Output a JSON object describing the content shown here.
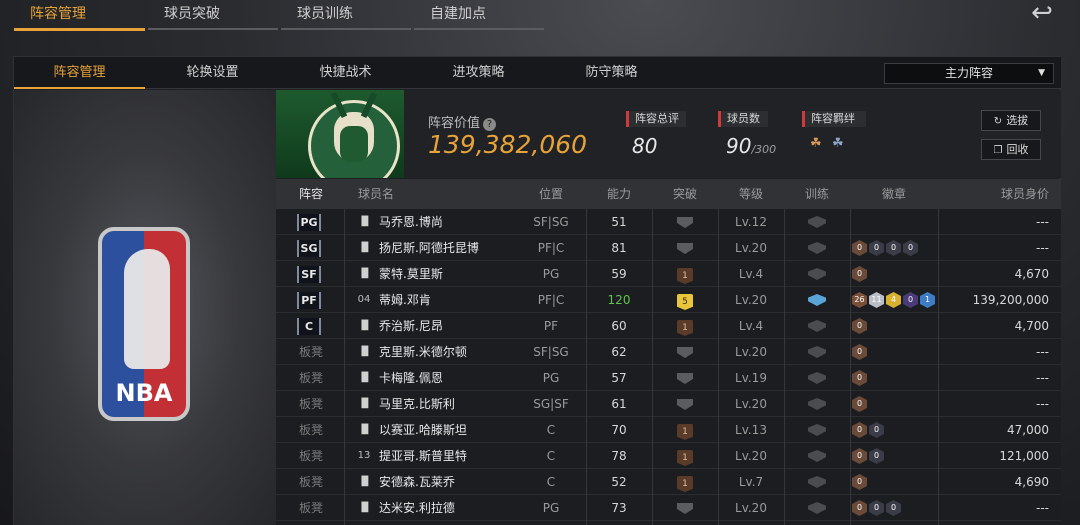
{
  "top_tabs": [
    "阵容管理",
    "球员突破",
    "球员训练",
    "自建加点"
  ],
  "sub_tabs": [
    "阵容管理",
    "轮换设置",
    "快捷战术",
    "进攻策略",
    "防守策略"
  ],
  "lineup_select": "主力阵容",
  "team": {
    "value_label": "阵容价值",
    "value": "139,382,060",
    "stats": [
      {
        "label": "阵容总评",
        "value": "80",
        "suffix": ""
      },
      {
        "label": "球员数",
        "value": "90",
        "suffix": "/300"
      },
      {
        "label": "阵容羁绊",
        "value": "",
        "suffix": ""
      }
    ],
    "buttons": [
      "选拔",
      "回收"
    ]
  },
  "columns": [
    "阵容",
    "球员名",
    "位置",
    "能力",
    "突破",
    "等级",
    "训练",
    "徽章",
    "球员身价"
  ],
  "rows": [
    {
      "slot": "PG",
      "starter": true,
      "num": "",
      "name": "马乔恩.博尚",
      "position": "SF|SG",
      "rating": "51",
      "breakthrough": "",
      "level": "Lv.12",
      "train": false,
      "badges": [],
      "salary": "---"
    },
    {
      "slot": "SG",
      "starter": true,
      "num": "",
      "name": "扬尼斯.阿德托昆博",
      "position": "PF|C",
      "rating": "81",
      "breakthrough": "",
      "level": "Lv.20",
      "train": false,
      "badges": [
        "0",
        "0",
        "0",
        "0"
      ],
      "salary": "---"
    },
    {
      "slot": "SF",
      "starter": true,
      "num": "",
      "name": "蒙特.莫里斯",
      "position": "PG",
      "rating": "59",
      "breakthrough": "1",
      "level": "Lv.4",
      "train": false,
      "badges": [
        "0"
      ],
      "salary": "4,670"
    },
    {
      "slot": "PF",
      "starter": true,
      "num": "04",
      "name": "蒂姆.邓肯",
      "position": "PF|C",
      "rating": "120",
      "breakthrough": "5",
      "level": "Lv.20",
      "train": true,
      "badges": [
        "26",
        "11",
        "4",
        "0",
        "1"
      ],
      "salary": "139,200,000"
    },
    {
      "slot": "C",
      "starter": true,
      "num": "",
      "name": "乔治斯.尼昂",
      "position": "PF",
      "rating": "60",
      "breakthrough": "1",
      "level": "Lv.4",
      "train": false,
      "badges": [
        "0"
      ],
      "salary": "4,700"
    },
    {
      "slot": "板凳",
      "starter": false,
      "num": "",
      "name": "克里斯.米德尔顿",
      "position": "SF|SG",
      "rating": "62",
      "breakthrough": "",
      "level": "Lv.20",
      "train": false,
      "badges": [
        "0"
      ],
      "salary": "---"
    },
    {
      "slot": "板凳",
      "starter": false,
      "num": "",
      "name": "卡梅隆.佩恩",
      "position": "PG",
      "rating": "57",
      "breakthrough": "",
      "level": "Lv.19",
      "train": false,
      "badges": [
        "0"
      ],
      "salary": "---"
    },
    {
      "slot": "板凳",
      "starter": false,
      "num": "",
      "name": "马里克.比斯利",
      "position": "SG|SF",
      "rating": "61",
      "breakthrough": "",
      "level": "Lv.20",
      "train": false,
      "badges": [
        "0"
      ],
      "salary": "---"
    },
    {
      "slot": "板凳",
      "starter": false,
      "num": "",
      "name": "以赛亚.哈滕斯坦",
      "position": "C",
      "rating": "70",
      "breakthrough": "1",
      "level": "Lv.13",
      "train": false,
      "badges": [
        "0",
        "0"
      ],
      "salary": "47,000"
    },
    {
      "slot": "板凳",
      "starter": false,
      "num": "13",
      "name": "提亚哥.斯普里特",
      "position": "C",
      "rating": "78",
      "breakthrough": "1",
      "level": "Lv.20",
      "train": false,
      "badges": [
        "0",
        "0"
      ],
      "salary": "121,000"
    },
    {
      "slot": "板凳",
      "starter": false,
      "num": "",
      "name": "安德森.瓦莱乔",
      "position": "C",
      "rating": "52",
      "breakthrough": "1",
      "level": "Lv.7",
      "train": false,
      "badges": [
        "0"
      ],
      "salary": "4,690"
    },
    {
      "slot": "板凳",
      "starter": false,
      "num": "",
      "name": "达米安.利拉德",
      "position": "PG",
      "rating": "73",
      "breakthrough": "",
      "level": "Lv.20",
      "train": false,
      "badges": [
        "0",
        "0",
        "0"
      ],
      "salary": "---"
    }
  ],
  "logo_text": "NBA",
  "colors": {
    "accent": "#e7a33a",
    "highlight_rating": "#5ec24a",
    "stat_bar": "#d23a3a"
  }
}
